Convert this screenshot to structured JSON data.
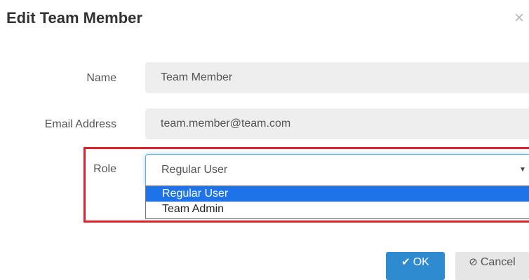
{
  "dialog": {
    "title": "Edit Team Member",
    "close_glyph": "×"
  },
  "form": {
    "name_label": "Name",
    "name_value": "Team Member",
    "email_label": "Email Address",
    "email_value": "team.member@team.com",
    "role_label": "Role",
    "role_value": "Regular User",
    "role_options": [
      "Regular User",
      "Team Admin"
    ]
  },
  "buttons": {
    "ok_label": "OK",
    "ok_icon": "✔",
    "cancel_label": "Cancel",
    "cancel_icon": "⊘"
  },
  "colors": {
    "highlight": "#e0202a",
    "primary": "#2f8bd0",
    "selected_option": "#1e73e8"
  }
}
